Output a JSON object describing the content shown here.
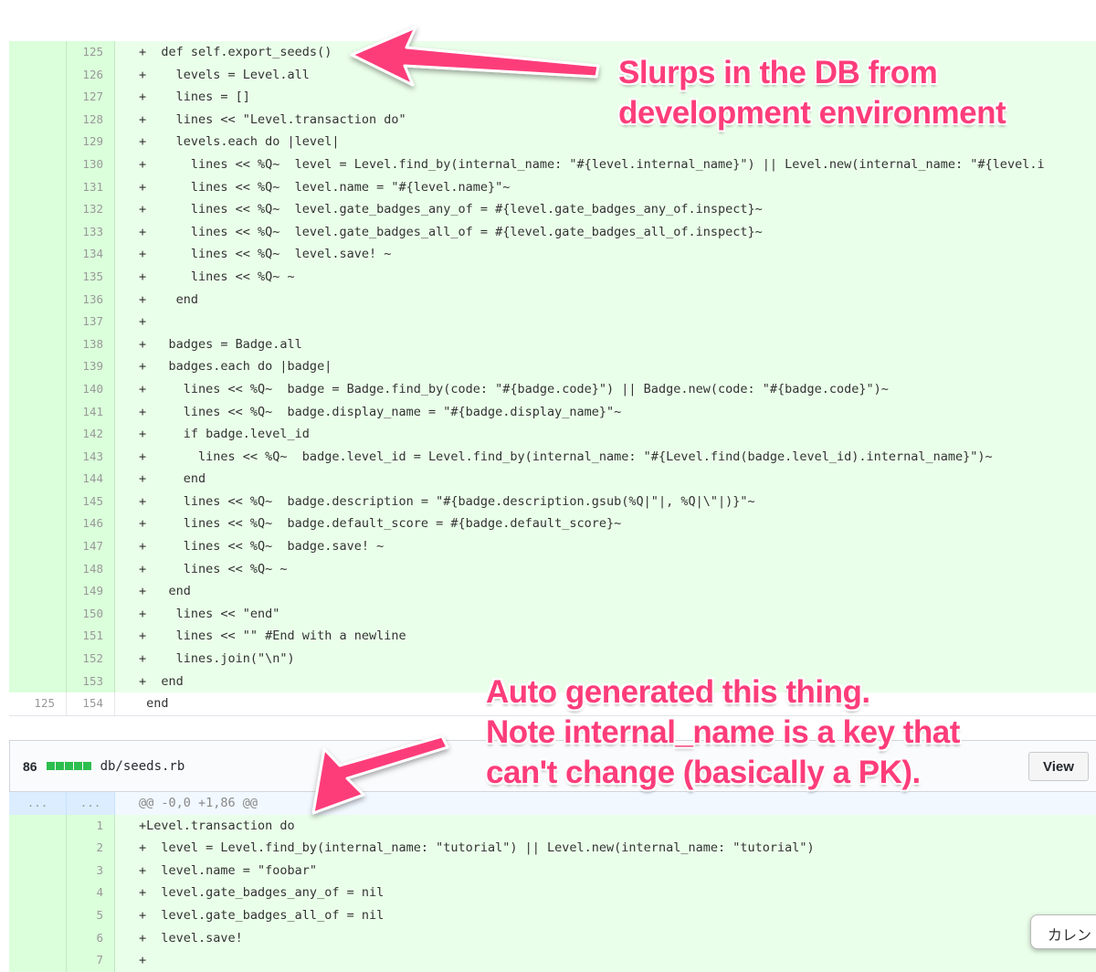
{
  "diff1": {
    "rows": [
      {
        "old": "",
        "new": "125",
        "code": "+  def self.export_seeds()",
        "type": "add"
      },
      {
        "old": "",
        "new": "126",
        "code": "+    levels = Level.all",
        "type": "add"
      },
      {
        "old": "",
        "new": "127",
        "code": "+    lines = []",
        "type": "add"
      },
      {
        "old": "",
        "new": "128",
        "code": "+    lines << \"Level.transaction do\"",
        "type": "add"
      },
      {
        "old": "",
        "new": "129",
        "code": "+    levels.each do |level|",
        "type": "add"
      },
      {
        "old": "",
        "new": "130",
        "code": "+      lines << %Q~  level = Level.find_by(internal_name: \"#{level.internal_name}\") || Level.new(internal_name: \"#{level.i",
        "type": "add"
      },
      {
        "old": "",
        "new": "131",
        "code": "+      lines << %Q~  level.name = \"#{level.name}\"~",
        "type": "add"
      },
      {
        "old": "",
        "new": "132",
        "code": "+      lines << %Q~  level.gate_badges_any_of = #{level.gate_badges_any_of.inspect}~",
        "type": "add"
      },
      {
        "old": "",
        "new": "133",
        "code": "+      lines << %Q~  level.gate_badges_all_of = #{level.gate_badges_all_of.inspect}~",
        "type": "add"
      },
      {
        "old": "",
        "new": "134",
        "code": "+      lines << %Q~  level.save! ~",
        "type": "add"
      },
      {
        "old": "",
        "new": "135",
        "code": "+      lines << %Q~ ~",
        "type": "add"
      },
      {
        "old": "",
        "new": "136",
        "code": "+    end",
        "type": "add"
      },
      {
        "old": "",
        "new": "137",
        "code": "+",
        "type": "add"
      },
      {
        "old": "",
        "new": "138",
        "code": "+   badges = Badge.all",
        "type": "add"
      },
      {
        "old": "",
        "new": "139",
        "code": "+   badges.each do |badge|",
        "type": "add"
      },
      {
        "old": "",
        "new": "140",
        "code": "+     lines << %Q~  badge = Badge.find_by(code: \"#{badge.code}\") || Badge.new(code: \"#{badge.code}\")~",
        "type": "add"
      },
      {
        "old": "",
        "new": "141",
        "code": "+     lines << %Q~  badge.display_name = \"#{badge.display_name}\"~",
        "type": "add"
      },
      {
        "old": "",
        "new": "142",
        "code": "+     if badge.level_id",
        "type": "add"
      },
      {
        "old": "",
        "new": "143",
        "code": "+       lines << %Q~  badge.level_id = Level.find_by(internal_name: \"#{Level.find(badge.level_id).internal_name}\")~",
        "type": "add"
      },
      {
        "old": "",
        "new": "144",
        "code": "+     end",
        "type": "add"
      },
      {
        "old": "",
        "new": "145",
        "code": "+     lines << %Q~  badge.description = \"#{badge.description.gsub(%Q|\"|, %Q|\\\"|)}\"~",
        "type": "add"
      },
      {
        "old": "",
        "new": "146",
        "code": "+     lines << %Q~  badge.default_score = #{badge.default_score}~",
        "type": "add"
      },
      {
        "old": "",
        "new": "147",
        "code": "+     lines << %Q~  badge.save! ~",
        "type": "add"
      },
      {
        "old": "",
        "new": "148",
        "code": "+     lines << %Q~ ~",
        "type": "add"
      },
      {
        "old": "",
        "new": "149",
        "code": "+   end",
        "type": "add"
      },
      {
        "old": "",
        "new": "150",
        "code": "+    lines << \"end\"",
        "type": "add"
      },
      {
        "old": "",
        "new": "151",
        "code": "+    lines << \"\" #End with a newline",
        "type": "add"
      },
      {
        "old": "",
        "new": "152",
        "code": "+    lines.join(\"\\n\")",
        "type": "add"
      },
      {
        "old": "",
        "new": "153",
        "code": "+  end",
        "type": "add"
      },
      {
        "old": "125",
        "new": "154",
        "code": " end",
        "type": "ctx"
      }
    ]
  },
  "file2": {
    "count": "86",
    "filename": "db/seeds.rb",
    "view_label": "View"
  },
  "diff2": {
    "rows": [
      {
        "old": "...",
        "new": "...",
        "code": "@@ -0,0 +1,86 @@",
        "type": "hunk"
      },
      {
        "old": "",
        "new": "1",
        "code": "+Level.transaction do",
        "type": "add"
      },
      {
        "old": "",
        "new": "2",
        "code": "+  level = Level.find_by(internal_name: \"tutorial\") || Level.new(internal_name: \"tutorial\")",
        "type": "add"
      },
      {
        "old": "",
        "new": "3",
        "code": "+  level.name = \"foobar\"",
        "type": "add"
      },
      {
        "old": "",
        "new": "4",
        "code": "+  level.gate_badges_any_of = nil",
        "type": "add"
      },
      {
        "old": "",
        "new": "5",
        "code": "+  level.gate_badges_all_of = nil",
        "type": "add"
      },
      {
        "old": "",
        "new": "6",
        "code": "+  level.save!",
        "type": "add"
      },
      {
        "old": "",
        "new": "7",
        "code": "+",
        "type": "add"
      }
    ]
  },
  "annotations": {
    "ann1_line1": "Slurps in the DB from",
    "ann1_line2": "development environment",
    "ann2_line1": "Auto generated this thing.",
    "ann2_line2": "Note internal_name is a key that",
    "ann2_line3": "can't change (basically a PK)."
  },
  "tooltip": "カレン",
  "colors": {
    "annotation": "#fd3d7a",
    "addition_bg": "#eaffea",
    "addition_gutter": "#dbffdb"
  }
}
